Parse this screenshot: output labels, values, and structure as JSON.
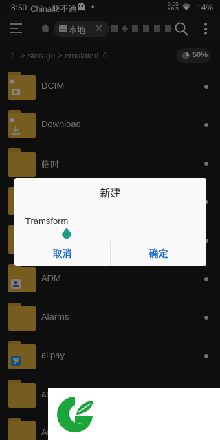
{
  "status_bar": {
    "time": "8:50",
    "carrier": "China联不通",
    "dot": "•",
    "net_speed_value": "0.00",
    "net_speed_unit": "KB/S",
    "battery": "14%"
  },
  "toolbar": {
    "tab_label": "本地",
    "tab_close": "✕"
  },
  "breadcrumb": {
    "root": "/",
    "path": "> storage > emulated",
    "count": "0",
    "usage": "50%"
  },
  "files": [
    {
      "name": "DCIM"
    },
    {
      "name": "Download"
    },
    {
      "name": "临时"
    },
    {
      "name": ""
    },
    {
      "name": ""
    },
    {
      "name": "ADM"
    },
    {
      "name": "Alarms"
    },
    {
      "name": "alipay"
    },
    {
      "name": "amap"
    },
    {
      "name": "Ar"
    }
  ],
  "dialog": {
    "title": "新建",
    "input_value": "Tramsform",
    "cancel_label": "取消",
    "ok_label": "确定"
  },
  "colors": {
    "folder": "#d7a838",
    "accent": "#1f6fd0",
    "caret": "#1e9a8a",
    "logo_green": "#1aa63a"
  }
}
